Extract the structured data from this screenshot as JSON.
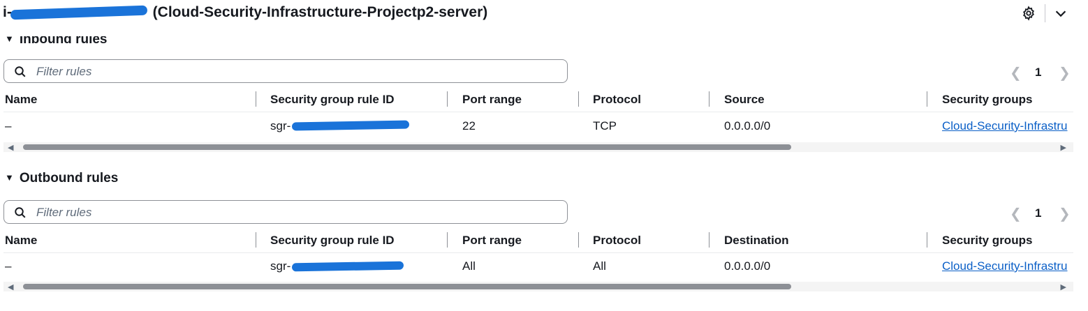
{
  "header": {
    "instance_prefix": "i-",
    "instance_name": "(Cloud-Security-Infrastructure-Projectp2-server)",
    "settings_icon": "gear-icon",
    "collapse_icon": "chevron-down-icon"
  },
  "inbound": {
    "title": "Inbound rules",
    "filter_placeholder": "Filter rules",
    "page": "1",
    "columns": [
      "Name",
      "Security group rule ID",
      "Port range",
      "Protocol",
      "Source",
      "Security groups"
    ],
    "rows": [
      {
        "name": "–",
        "rule_id": "sgr-",
        "port_range": "22",
        "protocol": "TCP",
        "source": "0.0.0.0/0",
        "security_group": "Cloud-Security-Infrastru"
      }
    ]
  },
  "outbound": {
    "title": "Outbound rules",
    "filter_placeholder": "Filter rules",
    "page": "1",
    "columns": [
      "Name",
      "Security group rule ID",
      "Port range",
      "Protocol",
      "Destination",
      "Security groups"
    ],
    "rows": [
      {
        "name": "–",
        "rule_id": "sgr-",
        "port_range": "All",
        "protocol": "All",
        "destination": "0.0.0.0/0",
        "security_group": "Cloud-Security-Infrastru"
      }
    ]
  },
  "colors": {
    "link": "#0a5fc7",
    "redaction": "#1a73d9"
  }
}
